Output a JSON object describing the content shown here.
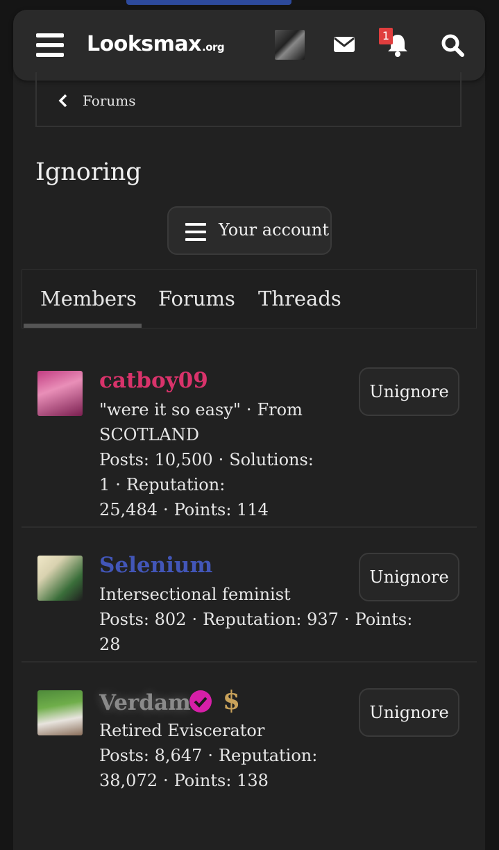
{
  "header": {
    "logo_text": "Looksmax",
    "logo_suffix": ".org",
    "notification_count": "1",
    "icons": [
      "menu-icon",
      "mail-icon",
      "bell-icon",
      "search-icon"
    ]
  },
  "breadcrumb": {
    "label": "Forums"
  },
  "page_title": "Ignoring",
  "account_button": {
    "label": "Your account"
  },
  "tabs": [
    {
      "label": "Members",
      "active": true
    },
    {
      "label": "Forums",
      "active": false
    },
    {
      "label": "Threads",
      "active": false
    }
  ],
  "members": [
    {
      "name": "catboy09",
      "name_color": "#d9336b",
      "line1": "\"were it so easy\"",
      "line1_sep": "·",
      "line1b": "From",
      "line2": "SCOTLAND",
      "line3a": "Posts: 10,500",
      "line3b": "Solutions: 1",
      "line3c": "Reputation:",
      "line4a": "25,484",
      "line4b": "Points: 114",
      "sep": "·",
      "button": "Unignore"
    },
    {
      "name": "Selenium",
      "name_color": "#4256b8",
      "line1": "Intersectional feminist",
      "line2a": "Posts: 802",
      "line2b": "Reputation: 937",
      "line2c": "Points: 28",
      "sep": "·",
      "button": "Unignore"
    },
    {
      "name": "Verdam",
      "name_color": "#8a8a8a",
      "line1": "Retired Eviscerator",
      "line2a": "Posts: 8,647",
      "line2b": "Reputation: 38,072",
      "line2c": "Points: 138",
      "sep": "·",
      "badge_symbol": "$",
      "button": "Unignore"
    }
  ],
  "colors": {
    "background": "#151515",
    "panel": "#212121",
    "badge_red": "#e03e3e",
    "verified_magenta": "#d61fa8",
    "gold": "#c9a25a"
  }
}
